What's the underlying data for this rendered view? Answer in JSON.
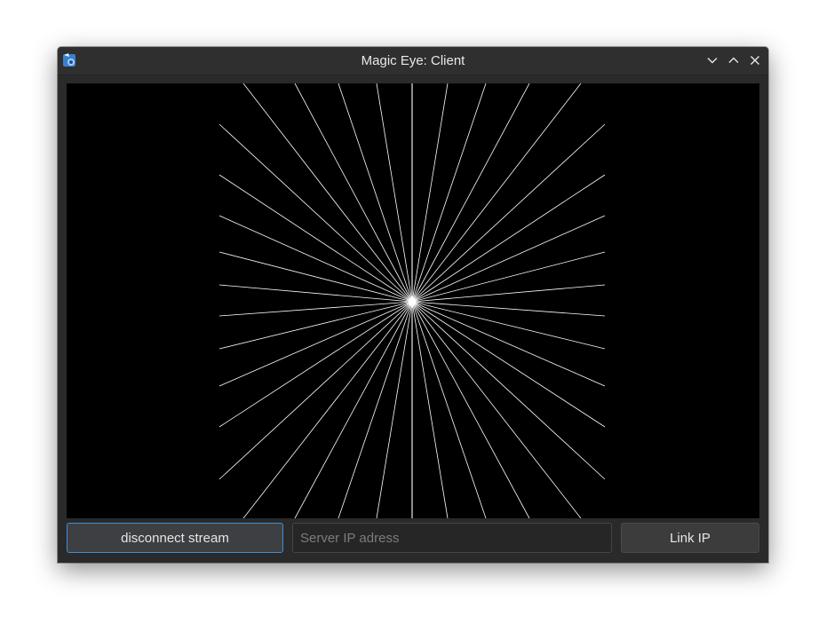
{
  "window": {
    "title": "Magic Eye: Client",
    "app_icon": "magic-eye-app-icon",
    "controls": [
      {
        "name": "minimize-button",
        "icon": "chevron-down-icon"
      },
      {
        "name": "maximize-button",
        "icon": "chevron-up-icon"
      },
      {
        "name": "close-button",
        "icon": "close-icon"
      }
    ]
  },
  "stream": {
    "background_color": "#000000",
    "ray_color": "#ffffff",
    "pattern": "starburst-rays"
  },
  "controls": {
    "disconnect_label": "disconnect stream",
    "server_ip_value": "",
    "server_ip_placeholder": "Server IP adress",
    "link_label": "Link IP"
  },
  "colors": {
    "focus_accent": "#3f8ed8",
    "window_bg": "#2a2a2a"
  }
}
